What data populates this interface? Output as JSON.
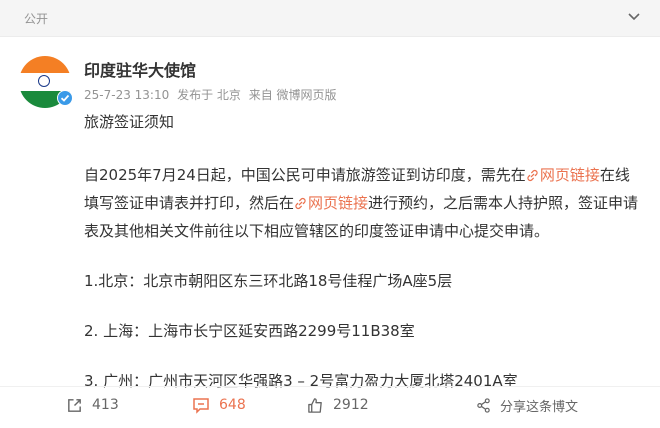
{
  "header": {
    "visibility": "公开",
    "collapse_icon": "chevron-down-icon"
  },
  "post": {
    "author": "印度驻华大使馆",
    "avatar": "india-flag-avatar",
    "verified_badge": "verified-badge-icon",
    "date": "25-7-23 13:10",
    "location": "发布于 北京",
    "source": "来自 微博网页版",
    "title": "旅游签证须知",
    "para1_a": "自2025年7月24日起，中国公民可申请旅游签证到访印度，需先在",
    "link1": "网页链接",
    "para1_b": "在线填写签证申请表并打印，然后在",
    "link2": "网页链接",
    "para1_c": "进行预约，之后需本人持护照，签证申请表及其他相关文件前往以下相应管辖区的印度签证申请中心提交申请。",
    "addr1": "1.北京：北京市朝阳区东三环北路18号佳程广场A座5层",
    "addr2": "2. 上海：上海市长宁区延安西路2299号11B38室",
    "addr3": "3. 广州：广州市天河区华强路3 – 2号富力盈力大厦北塔2401A室"
  },
  "actions": {
    "repost_count": "413",
    "comment_count": "648",
    "like_count": "2912",
    "site_share": "分享这条博文"
  },
  "colors": {
    "accent": "#eb7350",
    "meta_gray": "#939393",
    "saffron": "#f47f24",
    "green": "#1a8a3c",
    "chakra_blue": "#1b3a8a"
  }
}
